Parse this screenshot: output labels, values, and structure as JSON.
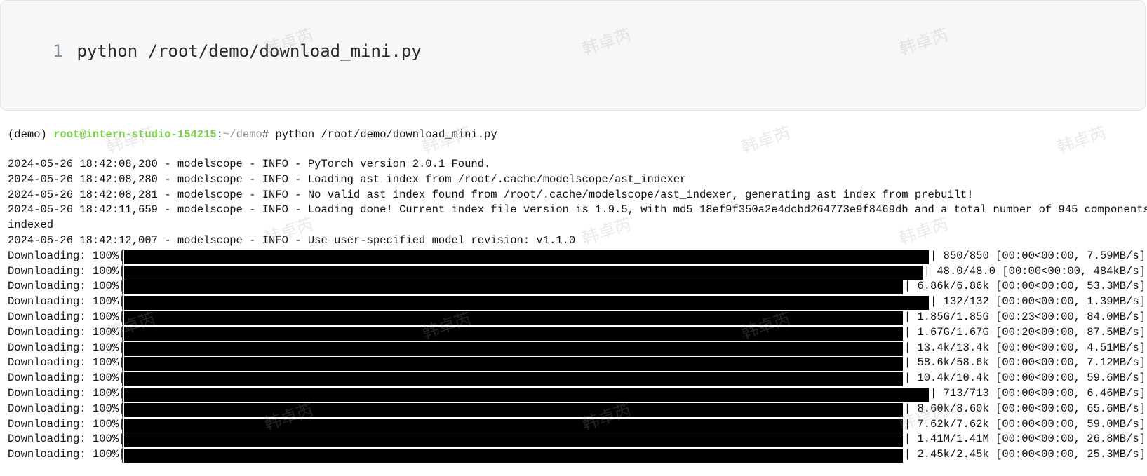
{
  "code_block": {
    "line_number": "1",
    "command": "python /root/demo/download_mini.py"
  },
  "terminal": {
    "prompt": {
      "env": "(demo) ",
      "user_host": "root@intern-studio-154215",
      "sep": ":",
      "path": "~/demo",
      "hash": "# ",
      "command": "python /root/demo/download_mini.py"
    },
    "log_lines": [
      "2024-05-26 18:42:08,280 - modelscope - INFO - PyTorch version 2.0.1 Found.",
      "2024-05-26 18:42:08,280 - modelscope - INFO - Loading ast index from /root/.cache/modelscope/ast_indexer",
      "2024-05-26 18:42:08,281 - modelscope - INFO - No valid ast index found from /root/.cache/modelscope/ast_indexer, generating ast index from prebuilt!",
      "2024-05-26 18:42:11,659 - modelscope - INFO - Loading done! Current index file version is 1.9.5, with md5 18ef9f350a2e4dcbd264773e9f8469db and a total number of 945 components",
      "indexed",
      "2024-05-26 18:42:12,007 - modelscope - INFO - Use user-specified model revision: v1.1.0"
    ],
    "downloads": [
      {
        "label": "Downloading: 100%|",
        "progress": 1.0,
        "stats": "| 850/850 [00:00<00:00, 7.59MB/s]"
      },
      {
        "label": "Downloading: 100%|",
        "progress": 1.0,
        "stats": "| 48.0/48.0 [00:00<00:00, 484kB/s]"
      },
      {
        "label": "Downloading: 100%|",
        "progress": 1.0,
        "stats": "| 6.86k/6.86k [00:00<00:00, 53.3MB/s]"
      },
      {
        "label": "Downloading: 100%|",
        "progress": 1.0,
        "stats": "| 132/132 [00:00<00:00, 1.39MB/s]"
      },
      {
        "label": "Downloading: 100%|",
        "progress": 1.0,
        "stats": "| 1.85G/1.85G [00:23<00:00, 84.0MB/s]"
      },
      {
        "label": "Downloading: 100%|",
        "progress": 1.0,
        "stats": "| 1.67G/1.67G [00:20<00:00, 87.5MB/s]"
      },
      {
        "label": "Downloading: 100%|",
        "progress": 1.0,
        "stats": "| 13.4k/13.4k [00:00<00:00, 4.51MB/s]"
      },
      {
        "label": "Downloading: 100%|",
        "progress": 1.0,
        "stats": "| 58.6k/58.6k [00:00<00:00, 7.12MB/s]"
      },
      {
        "label": "Downloading: 100%|",
        "progress": 1.0,
        "stats": "| 10.4k/10.4k [00:00<00:00, 59.6MB/s]"
      },
      {
        "label": "Downloading: 100%|",
        "progress": 1.0,
        "stats": "| 713/713 [00:00<00:00, 6.46MB/s]"
      },
      {
        "label": "Downloading: 100%|",
        "progress": 1.0,
        "stats": "| 8.60k/8.60k [00:00<00:00, 65.6MB/s]"
      },
      {
        "label": "Downloading: 100%|",
        "progress": 1.0,
        "stats": "| 7.62k/7.62k [00:00<00:00, 59.0MB/s]"
      },
      {
        "label": "Downloading: 100%|",
        "progress": 1.0,
        "stats": "| 1.41M/1.41M [00:00<00:00, 26.8MB/s]"
      },
      {
        "label": "Downloading: 100%|",
        "progress": 1.0,
        "stats": "| 2.45k/2.45k [00:00<00:00, 25.3MB/s]"
      }
    ]
  },
  "watermark": {
    "text": "韩卓芮"
  },
  "colors": {
    "prompt_user": "#7ad14b",
    "prompt_path": "#8f8f8f",
    "progress_bar": "#000000",
    "code_bg": "#f6f7f8"
  }
}
